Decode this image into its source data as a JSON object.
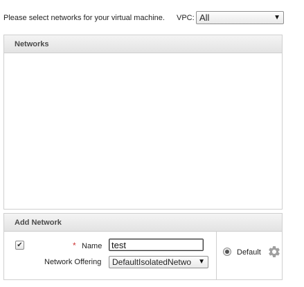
{
  "instruction": "Please select networks for your virtual machine.",
  "vpc": {
    "label": "VPC:",
    "selected": "All"
  },
  "networks_panel": {
    "title": "Networks"
  },
  "add_network": {
    "title": "Add Network",
    "checked": true,
    "name_label": "Name",
    "name_value": "test",
    "required_marker": "*",
    "offering_label": "Network Offering",
    "offering_selected": "DefaultIsolatedNetwo",
    "default_label": "Default"
  },
  "icons": {
    "dropdown": "chevron-down-icon",
    "settings": "gear-icon",
    "check": "check-icon"
  },
  "colors": {
    "required": "#cc3333",
    "panel_border": "#cfcfcf",
    "gear": "#a0a0a0"
  }
}
